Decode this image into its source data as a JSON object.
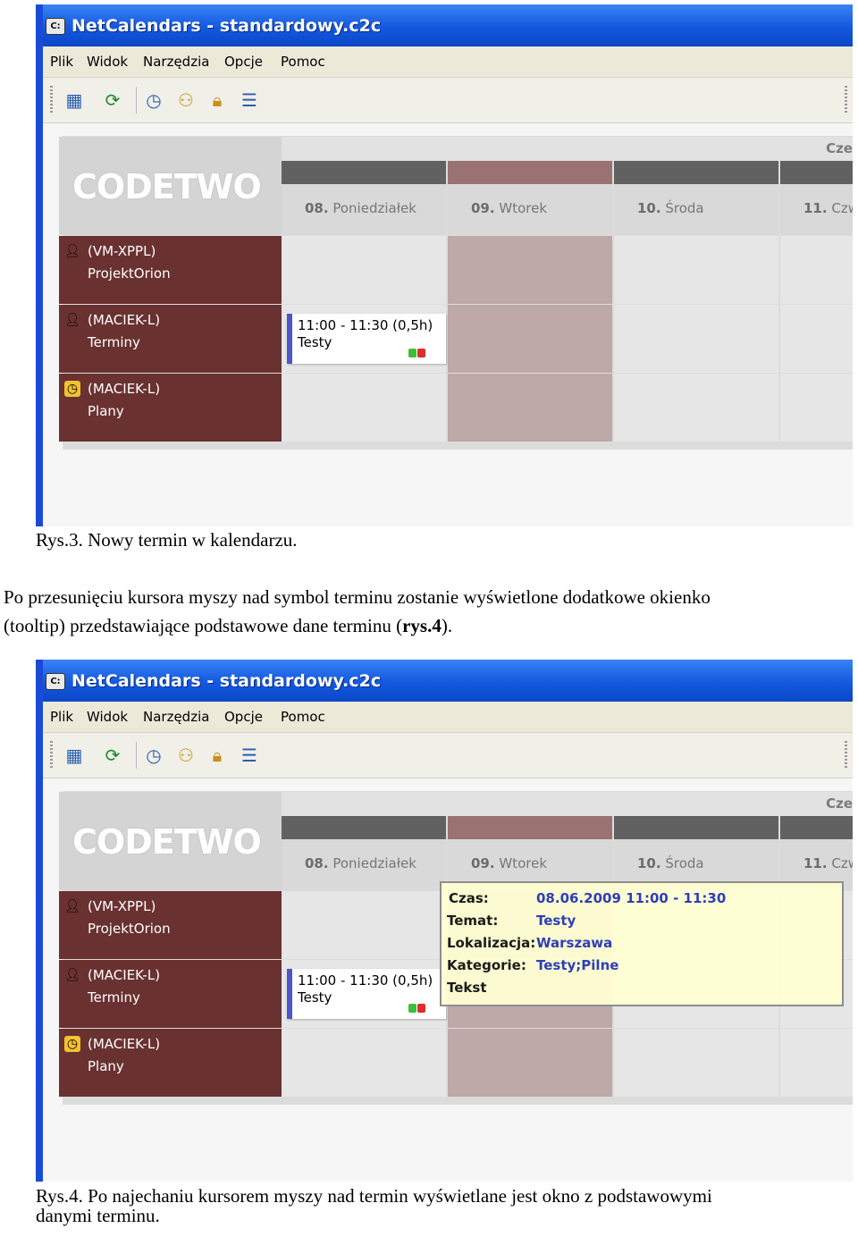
{
  "window": {
    "title": "NetCalendars - standardowy.c2c",
    "app_icon_text": "C:",
    "menu": [
      "Plik",
      "Widok",
      "Narzędzia",
      "Opcje",
      "Pomoc"
    ],
    "toolbar_icons": [
      "calendar-add-icon",
      "refresh-icon",
      "clock-icon",
      "users-icon",
      "lock-icon",
      "list-icon"
    ]
  },
  "calendar": {
    "logo": "CODETWO",
    "week_label": "Cze",
    "days": [
      {
        "num": "08.",
        "name": "Poniedziałek",
        "selected": false
      },
      {
        "num": "09.",
        "name": "Wtorek",
        "selected": true
      },
      {
        "num": "10.",
        "name": "Środa",
        "selected": false
      },
      {
        "num": "11.",
        "name": "Czw",
        "selected": false
      }
    ],
    "rows": [
      {
        "line1": "(VM-XPPL)",
        "line2": "ProjektOrion",
        "icon": "user-icon"
      },
      {
        "line1": "(MACIEK-L)",
        "line2": "Terminy",
        "icon": "user-icon"
      },
      {
        "line1": "(MACIEK-L)",
        "line2": "Plany",
        "icon": "clock-icon"
      }
    ],
    "event": {
      "time": "11:00 - 11:30 (0,5h)",
      "subject": "Testy"
    }
  },
  "tooltip": {
    "rows": [
      {
        "key": "Czas:",
        "value": "08.06.2009 11:00 - 11:30"
      },
      {
        "key": "Temat:",
        "value": "Testy"
      },
      {
        "key": "Lokalizacja:",
        "value": "Warszawa"
      },
      {
        "key": "Kategorie:",
        "value": "Testy;Pilne"
      },
      {
        "key": "Tekst",
        "value": ""
      }
    ]
  },
  "document": {
    "caption1": "Rys.3. Nowy termin w kalendarzu.",
    "paragraph_line1": "Po przesunięciu kursora myszy nad symbol terminu zostanie wyświetlone dodatkowe okienko",
    "paragraph_line2_pre": "(tooltip) przedstawiające podstawowe dane terminu (",
    "paragraph_ref": "rys.4",
    "paragraph_end": ").",
    "caption2_line1": "Rys.4. Po najechaniu kursorem myszy nad termin wyświetlane jest okno z podstawowymi",
    "caption2_line2": "danymi terminu."
  }
}
